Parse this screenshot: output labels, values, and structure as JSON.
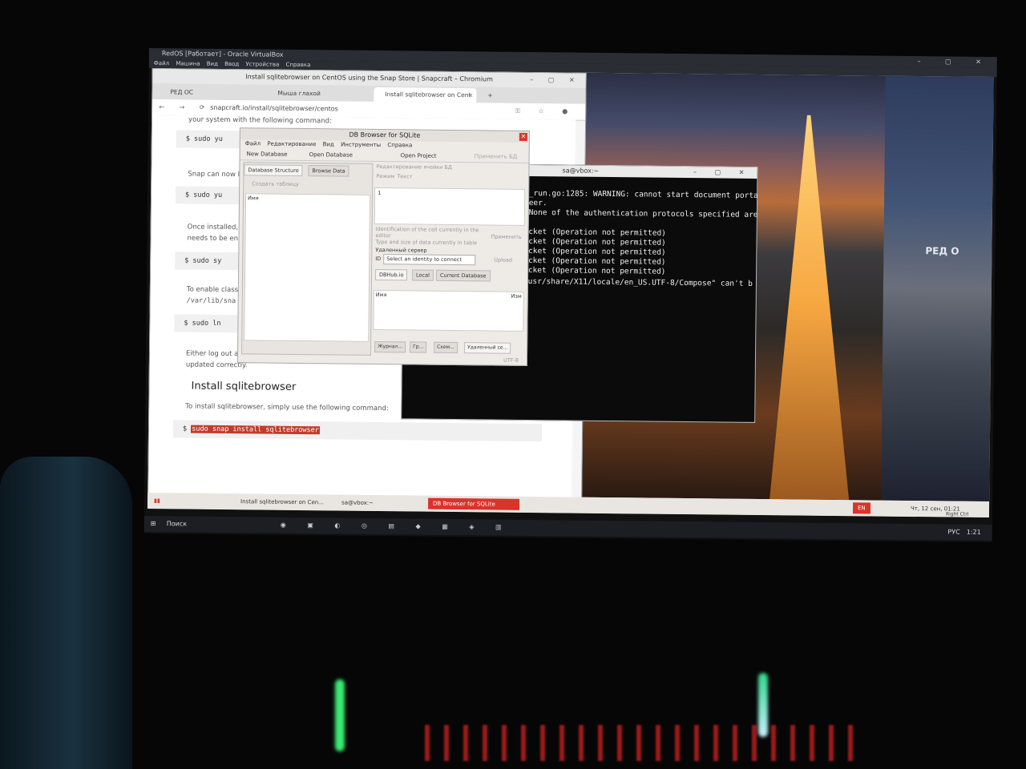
{
  "vbox": {
    "title": "RedOS [Работает] - Oracle VirtualBox",
    "controls": "– ▢ ✕",
    "menu": [
      "Файл",
      "Машина",
      "Вид",
      "Ввод",
      "Устройства",
      "Справка"
    ]
  },
  "chrome": {
    "title": "Install sqlitebrowser on CentOS using the Snap Store | Snapcraft – Chromium",
    "controls": "– ▢ ✕",
    "tabs": [
      {
        "label": "РЕД ОС"
      },
      {
        "label": "Мыша глахой"
      },
      {
        "label": "Install sqlitebrowser on Cent"
      }
    ],
    "new_tab": "+",
    "nav": "← → ⟳",
    "url": "snapcraft.io/install/sqlitebrowser/centos",
    "url_icons": "⚿ ☆ ●",
    "page": {
      "line0": "your system with the following command:",
      "cmd1": "$ sudo yu",
      "line1": "Snap can now b",
      "cmd2": "$ sudo yu",
      "line2a": "Once installed,",
      "line2b": "needs to be en",
      "cmd3": "$ sudo sy",
      "line3a": "To enable class",
      "line3b": "/var/lib/sna",
      "cmd4": "$ sudo ln",
      "line4a": "Either log out a",
      "line4b": "updated correctly.",
      "install_heading": "Install sqlitebrowser",
      "install_text": "To install sqlitebrowser, simply use the following command:",
      "install_prompt": "$",
      "install_cmd": "sudo snap install sqlitebrowser"
    }
  },
  "terminal": {
    "title": "sa@vbox:~",
    "controls": "– ▢ ✕",
    "lines": [
      "d_run.go:1285: WARNING: cannot start document porta",
      "peer.",
      " None of the authentication protocols specified are",
      "",
      "ocket (Operation not permitted)",
      "ocket (Operation not permitted)",
      "ocket (Operation not permitted)",
      "ocket (Operation not permitted)",
      "ocket (Operation not permitted)",
      "/usr/share/X11/locale/en_US.UTF-8/Compose\" can't b"
    ]
  },
  "dbbrowser": {
    "title": "DB Browser for SQLite",
    "close": "✕",
    "menu": [
      "Файл",
      "Редактирование",
      "Вид",
      "Инструменты",
      "Справка"
    ],
    "toolbar": {
      "new_db": "New Database",
      "open_db": "Open Database",
      "open_project": "Open Project",
      "apply": "Применить БД"
    },
    "tabs": [
      "Database Structure",
      "Browse Data"
    ],
    "create_table": "Создать таблицу",
    "tree_header": "Имя",
    "edit_cell_title": "Редактирование ячейки БД",
    "mode_label": "Режим",
    "mode_value": "Текст",
    "cell_value": "1",
    "cell_info1": "Identification of the cell currently in the editor",
    "cell_info2": "Type and size of data currently in table",
    "apply_btn": "Применить",
    "remote_title": "Удаленный сервер",
    "identity_label": "ID",
    "identity_value": "Select an identity to connect",
    "upload_btn": "Upload",
    "remote_tabs": [
      "DBHub.io",
      "Local",
      "Current Database"
    ],
    "remote_col_name": "Имя",
    "remote_col_changed": "Изм",
    "bottom_tabs": [
      "Журнал...",
      "Гр...",
      "Схем...",
      "Удаленный се..."
    ],
    "encoding": "UTF-8"
  },
  "guest_taskbar": {
    "items": [
      "Install sqlitebrowser on Cen...",
      "sa@vbox:~",
      "DB Browser for SQLite"
    ],
    "lang": "EN",
    "clock": "Чт, 12 сен, 01:21",
    "host_key": "Right Ctrl"
  },
  "host_taskbar": {
    "search": "Поиск",
    "lang": "РУС",
    "time": "1:21"
  },
  "wallpaper": {
    "logo": "РЕД О"
  },
  "colors": {
    "accent": "#d9342b",
    "terminal_bg": "#0b0b0b"
  }
}
